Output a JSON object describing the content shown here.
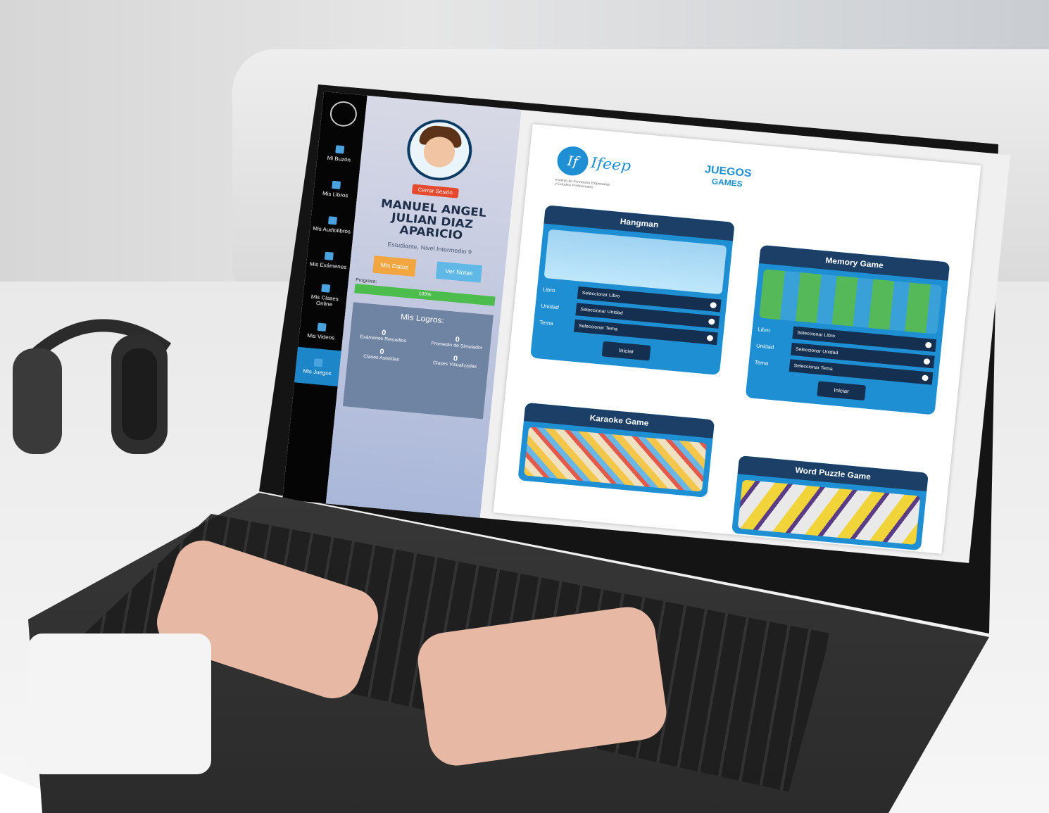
{
  "sidebar": {
    "items": [
      {
        "label": "Mi Buzón",
        "icon": "mailbox-icon"
      },
      {
        "label": "Mis Libros",
        "icon": "books-icon"
      },
      {
        "label": "Mis Audiolibros",
        "icon": "audiobook-icon"
      },
      {
        "label": "Mis Exámenes",
        "icon": "exam-icon"
      },
      {
        "label": "Mis Clases Online",
        "icon": "online-class-icon"
      },
      {
        "label": "Mis Videos",
        "icon": "video-icon"
      },
      {
        "label": "Mis Juegos",
        "icon": "games-icon",
        "active": true
      }
    ]
  },
  "profile": {
    "logout_label": "Cerrar Sesión",
    "name": "MANUEL ANGEL JULIAN DIAZ APARICIO",
    "role": "Estudiante, Nivel Intermedio 9",
    "data_button": "Mis Datos",
    "notes_button": "Ver Notas",
    "progress_label": "Progreso:",
    "progress_value": 1.0,
    "progress_text": "100%",
    "achievements": {
      "title": "Mis Logros:",
      "items": [
        {
          "value": "0",
          "label": "Exámenes Resueltos"
        },
        {
          "value": "0",
          "label": "Promedio de Simulador"
        },
        {
          "value": "0",
          "label": "Clases Asistidas"
        },
        {
          "value": "0",
          "label": "Clases Visualizadas"
        }
      ]
    }
  },
  "brand": {
    "logo_text": "Ifeep",
    "logo_sub": "Instituto de Formación Empresarial y Estudios Profesionales"
  },
  "page": {
    "title": "JUEGOS",
    "subtitle": "GAMES"
  },
  "games": [
    {
      "title": "Hangman",
      "fields": [
        {
          "label": "Libro",
          "value": "Seleccionar Libro"
        },
        {
          "label": "Unidad",
          "value": "Seleccionar Unidad"
        },
        {
          "label": "Tema",
          "value": "Seleccionar Tema"
        }
      ],
      "start_label": "Iniciar"
    },
    {
      "title": "Memory Game",
      "fields": [
        {
          "label": "Libro",
          "value": "Seleccionar Libro"
        },
        {
          "label": "Unidad",
          "value": "Seleccionar Unidad"
        },
        {
          "label": "Tema",
          "value": "Seleccionar Tema"
        }
      ],
      "start_label": "Iniciar"
    },
    {
      "title": "Karaoke Game"
    },
    {
      "title": "Word Puzzle Game"
    }
  ],
  "colors": {
    "accent": "#1f8fd3",
    "card_header": "#1b3f66",
    "progress": "#4cbc4d",
    "logout": "#e64a2e",
    "data_button": "#f3a640",
    "notes_button": "#5fb8e6"
  }
}
